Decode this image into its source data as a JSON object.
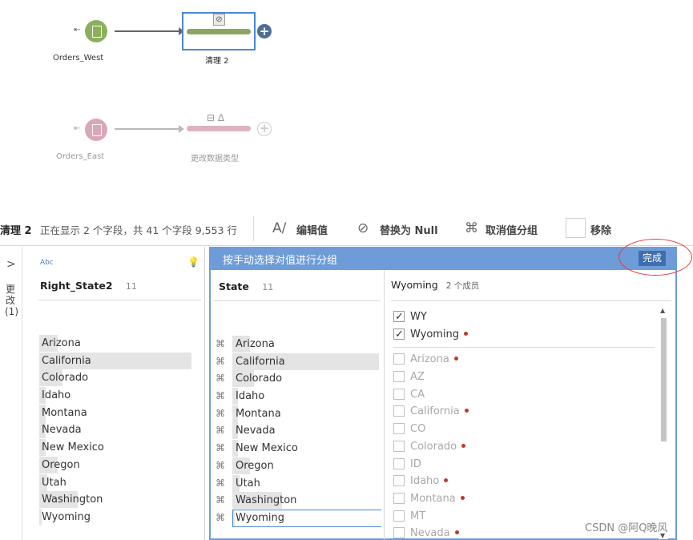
{
  "flow": {
    "west": {
      "label": "Orders_West",
      "color": "#8bb05a"
    },
    "east": {
      "label": "Orders_East",
      "color": "#dba6b6"
    },
    "clean2": {
      "label": "清理 2",
      "bar_color": "#8aa760",
      "plus_color": "#4e6d96"
    },
    "change_type": {
      "label": "更改数据类型",
      "bar_color": "#ddb2bf"
    }
  },
  "toolbar": {
    "title": "清理 2",
    "status": "正在显示 2 个字段，共 41 个字段 9,553 行",
    "edit_value": "编辑值",
    "replace_null": "替换为 Null",
    "ungroup": "取消值分组",
    "remove": "移除"
  },
  "changes": {
    "label": "更改(1)"
  },
  "field_card": {
    "type_label": "Abc",
    "name": "Right_State2",
    "count": "11",
    "values": [
      {
        "label": "Arizona",
        "fill": 0.12
      },
      {
        "label": "California",
        "fill": 1.0
      },
      {
        "label": "Colorado",
        "fill": 0.15
      },
      {
        "label": "Idaho",
        "fill": 0.04
      },
      {
        "label": "Montana",
        "fill": 0.04
      },
      {
        "label": "Nevada",
        "fill": 0.04
      },
      {
        "label": "New Mexico",
        "fill": 0.04
      },
      {
        "label": "Oregon",
        "fill": 0.12
      },
      {
        "label": "Utah",
        "fill": 0.05
      },
      {
        "label": "Washington",
        "fill": 0.25
      },
      {
        "label": "Wyoming",
        "fill": 0.01
      }
    ]
  },
  "group_panel": {
    "title": "按手动选择对值进行分组",
    "done": "完成",
    "state_field": {
      "name": "State",
      "count": "11"
    },
    "states": [
      {
        "label": "Arizona",
        "fill": 0.12
      },
      {
        "label": "California",
        "fill": 1.0
      },
      {
        "label": "Colorado",
        "fill": 0.15
      },
      {
        "label": "Idaho",
        "fill": 0.04
      },
      {
        "label": "Montana",
        "fill": 0.04
      },
      {
        "label": "Nevada",
        "fill": 0.04
      },
      {
        "label": "New Mexico",
        "fill": 0.04
      },
      {
        "label": "Oregon",
        "fill": 0.12
      },
      {
        "label": "Utah",
        "fill": 0.05
      },
      {
        "label": "Washington",
        "fill": 0.34
      },
      {
        "label": "Wyoming",
        "fill": 0.01,
        "selected": true
      }
    ],
    "group": {
      "name": "Wyoming",
      "count_label": "2 个成员"
    },
    "members_checked": [
      {
        "label": "WY",
        "dot": false
      },
      {
        "label": "Wyoming",
        "dot": true
      }
    ],
    "members_other": [
      {
        "label": "Arizona",
        "dot": true
      },
      {
        "label": "AZ",
        "dot": false
      },
      {
        "label": "CA",
        "dot": false
      },
      {
        "label": "California",
        "dot": true
      },
      {
        "label": "CO",
        "dot": false
      },
      {
        "label": "Colorado",
        "dot": true
      },
      {
        "label": "ID",
        "dot": false
      },
      {
        "label": "Idaho",
        "dot": true
      },
      {
        "label": "Montana",
        "dot": true
      },
      {
        "label": "MT",
        "dot": false
      },
      {
        "label": "Nevada",
        "dot": true
      }
    ]
  },
  "watermark": "CSDN @阿Q晚风"
}
